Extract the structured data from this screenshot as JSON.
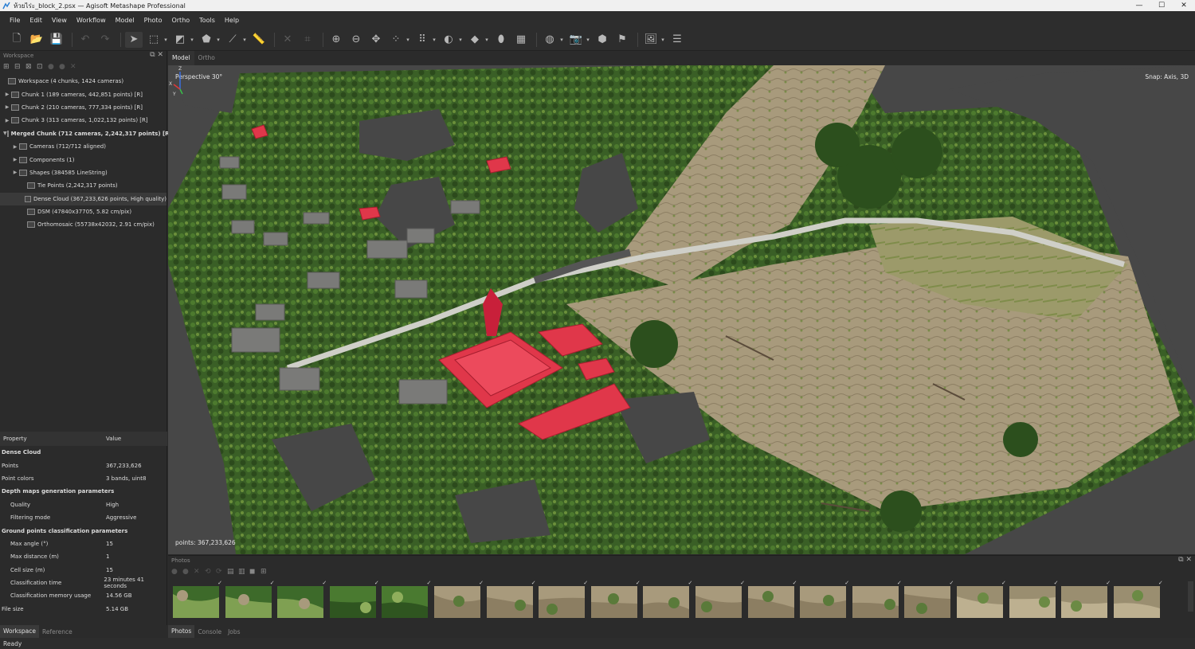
{
  "window": {
    "title": "ห้วยไร่ะ_block_2.psx — Agisoft Metashape Professional",
    "minimize": "—",
    "maximize": "☐",
    "close": "✕"
  },
  "menu": [
    "File",
    "Edit",
    "View",
    "Workflow",
    "Model",
    "Photo",
    "Ortho",
    "Tools",
    "Help"
  ],
  "workspace": {
    "panel_title": "Workspace",
    "tree": [
      {
        "label": "Workspace (4 chunks, 1424 cameras)",
        "level": 0,
        "arrow": "",
        "bold": false
      },
      {
        "label": "Chunk 1 (189 cameras, 442,851 points) [R]",
        "level": 1,
        "arrow": "▶",
        "bold": false
      },
      {
        "label": "Chunk 2 (210 cameras, 777,334 points) [R]",
        "level": 1,
        "arrow": "▶",
        "bold": false
      },
      {
        "label": "Chunk 3 (313 cameras, 1,022,132 points) [R]",
        "level": 1,
        "arrow": "▶",
        "bold": false
      },
      {
        "label": "Merged Chunk (712 cameras, 2,242,317 points) [R]",
        "level": 1,
        "arrow": "▼",
        "bold": true
      },
      {
        "label": "Cameras (712/712 aligned)",
        "level": 2,
        "arrow": "▶",
        "bold": false
      },
      {
        "label": "Components (1)",
        "level": 2,
        "arrow": "▶",
        "bold": false
      },
      {
        "label": "Shapes (384585 LineString)",
        "level": 2,
        "arrow": "▶",
        "bold": false
      },
      {
        "label": "Tie Points (2,242,317 points)",
        "level": 3,
        "arrow": "",
        "bold": false
      },
      {
        "label": "Dense Cloud (367,233,626 points, High quality)",
        "level": 3,
        "arrow": "",
        "bold": false,
        "selected": true
      },
      {
        "label": "DSM (47840x37705, 5.82 cm/pix)",
        "level": 3,
        "arrow": "",
        "bold": false
      },
      {
        "label": "Orthomosaic (55738x42032, 2.91 cm/pix)",
        "level": 3,
        "arrow": "",
        "bold": false
      }
    ]
  },
  "properties": {
    "col_property": "Property",
    "col_value": "Value",
    "rows": [
      {
        "key": "Dense Cloud",
        "value": "",
        "type": "group"
      },
      {
        "key": "Points",
        "value": "367,233,626",
        "type": "row"
      },
      {
        "key": "Point colors",
        "value": "3 bands, uint8",
        "type": "row"
      },
      {
        "key": "Depth maps generation parameters",
        "value": "",
        "type": "group"
      },
      {
        "key": "Quality",
        "value": "High",
        "type": "sub"
      },
      {
        "key": "Filtering mode",
        "value": "Aggressive",
        "type": "sub"
      },
      {
        "key": "Ground points classification parameters",
        "value": "",
        "type": "group"
      },
      {
        "key": "Max angle (°)",
        "value": "15",
        "type": "sub"
      },
      {
        "key": "Max distance (m)",
        "value": "1",
        "type": "sub"
      },
      {
        "key": "Cell size (m)",
        "value": "15",
        "type": "sub"
      },
      {
        "key": "Classification time",
        "value": "23 minutes 41 seconds",
        "type": "sub"
      },
      {
        "key": "Classification memory usage",
        "value": "14.56 GB",
        "type": "sub"
      },
      {
        "key": "File size",
        "value": "5.14 GB",
        "type": "row"
      }
    ]
  },
  "left_tabs": [
    "Workspace",
    "Reference"
  ],
  "view_tabs": [
    "Model",
    "Ortho"
  ],
  "viewport": {
    "perspective": "Perspective 30°",
    "snap": "Snap: Axis, 3D",
    "points": "points: 367,233,626",
    "axis_labels": {
      "z": "Z",
      "x": "X",
      "y": "Y"
    }
  },
  "photos": {
    "panel_title": "Photos",
    "count_visible": 19,
    "checkmark": "✓"
  },
  "bottom_tabs": [
    "Photos",
    "Console",
    "Jobs"
  ],
  "status": "Ready",
  "colors": {
    "panel_bg": "#2b2b2b",
    "viewport_bg": "#474747",
    "roof_red": "#e0374a",
    "vegetation": "#3e6b2a",
    "bare_soil": "#a89a7c"
  }
}
